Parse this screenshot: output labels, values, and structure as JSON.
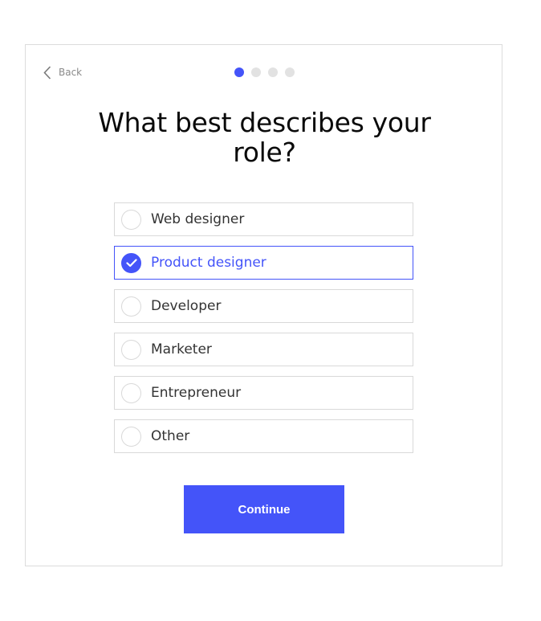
{
  "header": {
    "back_label": "Back",
    "back_icon": "chevron-left-icon",
    "steps_total": 4,
    "current_step": 1
  },
  "question": {
    "title": "What best describes your role?"
  },
  "options": [
    {
      "label": "Web designer",
      "selected": false
    },
    {
      "label": "Product designer",
      "selected": true
    },
    {
      "label": "Developer",
      "selected": false
    },
    {
      "label": "Marketer",
      "selected": false
    },
    {
      "label": "Entrepreneur",
      "selected": false
    },
    {
      "label": "Other",
      "selected": false
    }
  ],
  "actions": {
    "continue_label": "Continue"
  },
  "colors": {
    "accent": "#4454f9",
    "border": "#d9d9d9",
    "inactive_dot": "#e2e2e2"
  }
}
